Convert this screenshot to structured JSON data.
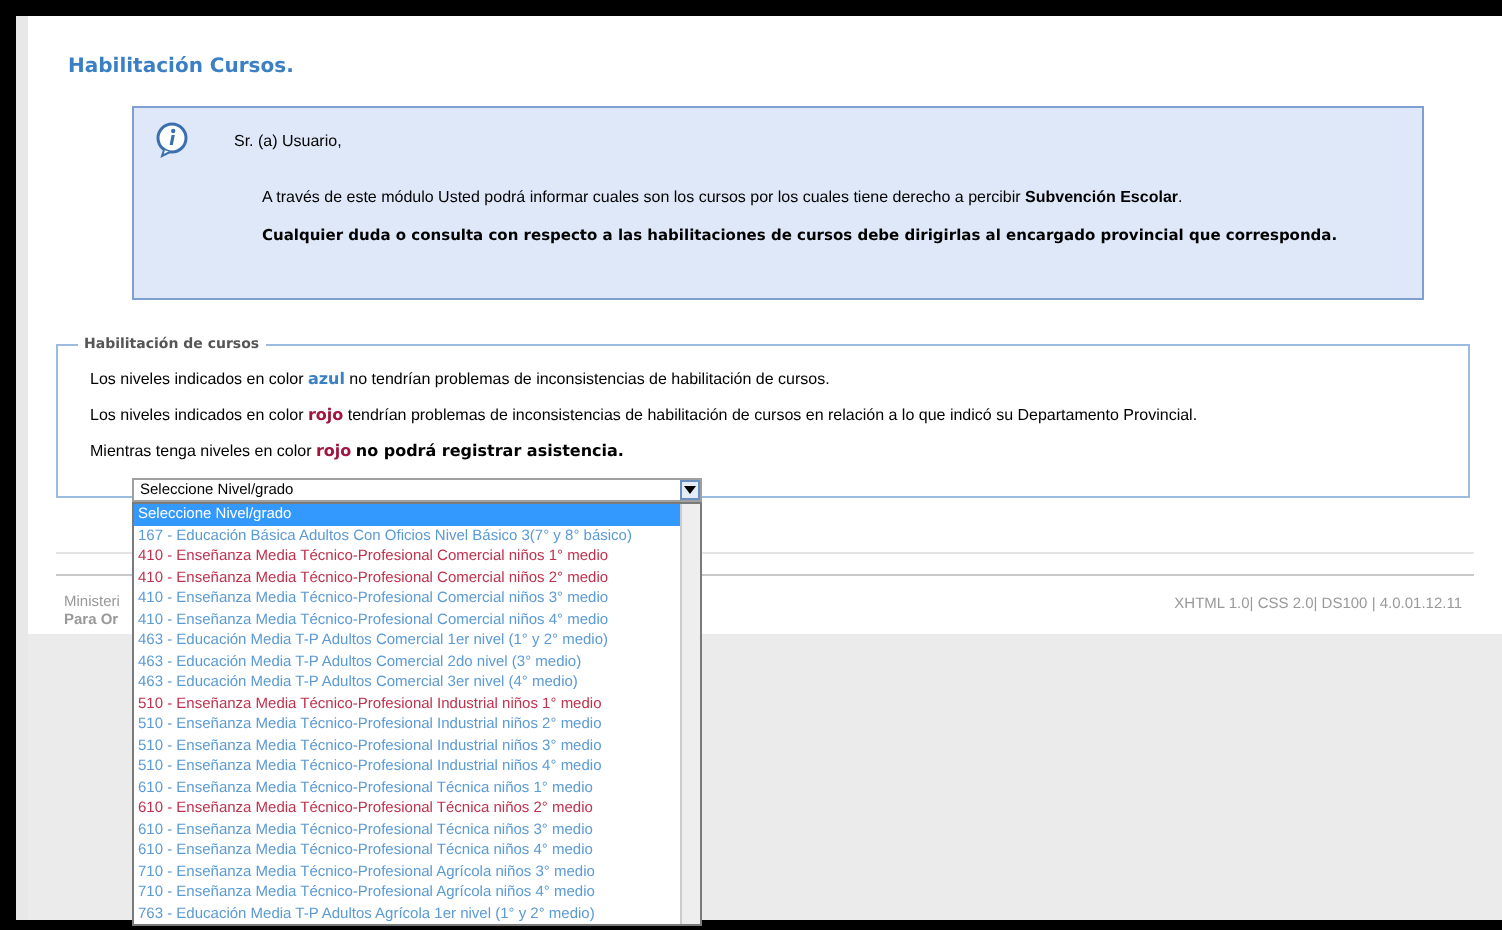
{
  "page_title": "Habilitación Cursos.",
  "info_box": {
    "greeting": "Sr. (a) Usuario,",
    "message": "A través de este módulo Usted podrá informar cuales son los cursos por los cuales tiene derecho a percibir **Subvención Escolar**.",
    "note": "Cualquier duda o consulta con respecto a las habilitaciones de cursos debe dirigirlas al encargado provincial que corresponda."
  },
  "fieldset": {
    "legend": "Habilitación de cursos",
    "lines": [
      "Los niveles indicados en color **azul** no tendrían problemas de inconsistencias de habilitación de cursos.",
      "Los niveles indicados en color **rojo** tendrían problemas de inconsistencias de habilitación de cursos en relación a lo que indicó su Departamento Provincial.",
      "Mientras tenga niveles en color **rojo** **no podrá registrar asistencia.**"
    ],
    "select": {
      "value": "Seleccione Nivel/grado",
      "expanded": true,
      "options": [
        {
          "label": "Seleccione Nivel/grado",
          "selected": true
        },
        {
          "label": "167 - Educación Básica Adultos Con Oficios Nivel Básico 3(7° y 8° básico)",
          "selected": false,
          "color": "#5b9bd5"
        },
        {
          "label": "410 - Enseñanza Media Técnico-Profesional Comercial niños 1° medio",
          "selected": false,
          "color": "#c0314d"
        },
        {
          "label": "410 - Enseñanza Media Técnico-Profesional Comercial niños 2° medio",
          "selected": false,
          "color": "#c0314d"
        },
        {
          "label": "410 - Enseñanza Media Técnico-Profesional Comercial niños 3° medio",
          "selected": false,
          "color": "#5b9bd5"
        },
        {
          "label": "410 - Enseñanza Media Técnico-Profesional Comercial niños 4° medio",
          "selected": false,
          "color": "#5b9bd5"
        },
        {
          "label": "463 - Educación Media T-P Adultos Comercial 1er nivel (1° y 2° medio)",
          "selected": false,
          "color": "#5b9bd5"
        },
        {
          "label": "463 - Educación Media T-P Adultos Comercial 2do nivel (3° medio)",
          "selected": false,
          "color": "#5b9bd5"
        },
        {
          "label": "463 - Educación Media T-P Adultos Comercial 3er nivel (4° medio)",
          "selected": false,
          "color": "#5b9bd5"
        },
        {
          "label": "510 - Enseñanza Media Técnico-Profesional Industrial niños 1° medio",
          "selected": false,
          "color": "#c0314d"
        },
        {
          "label": "510 - Enseñanza Media Técnico-Profesional Industrial niños 2° medio",
          "selected": false,
          "color": "#5b9bd5"
        },
        {
          "label": "510 - Enseñanza Media Técnico-Profesional Industrial niños 3° medio",
          "selected": false,
          "color": "#5b9bd5"
        },
        {
          "label": "510 - Enseñanza Media Técnico-Profesional Industrial niños 4° medio",
          "selected": false,
          "color": "#5b9bd5"
        },
        {
          "label": "610 - Enseñanza Media Técnico-Profesional Técnica niños 1° medio",
          "selected": false,
          "color": "#5b9bd5"
        },
        {
          "label": "610 - Enseñanza Media Técnico-Profesional Técnica niños 2° medio",
          "selected": false,
          "color": "#c0314d"
        },
        {
          "label": "610 - Enseñanza Media Técnico-Profesional Técnica niños 3° medio",
          "selected": false,
          "color": "#5b9bd5"
        },
        {
          "label": "610 - Enseñanza Media Técnico-Profesional Técnica niños 4° medio",
          "selected": false,
          "color": "#5b9bd5"
        },
        {
          "label": "710 - Enseñanza Media Técnico-Profesional Agrícola niños 3° medio",
          "selected": false,
          "color": "#5b9bd5"
        },
        {
          "label": "710 - Enseñanza Media Técnico-Profesional Agrícola niños 4° medio",
          "selected": false,
          "color": "#5b9bd5"
        },
        {
          "label": "763 - Educación Media T-P Adultos Agrícola 1er nivel (1° y 2° medio)",
          "selected": false,
          "color": "#5b9bd5"
        }
      ]
    }
  },
  "footer": {
    "left_lines": [
      "Ministeri",
      "Para Or"
    ],
    "right": "XHTML 1.0| CSS 2.0| DS100 | 4.0.01.12.11"
  }
}
